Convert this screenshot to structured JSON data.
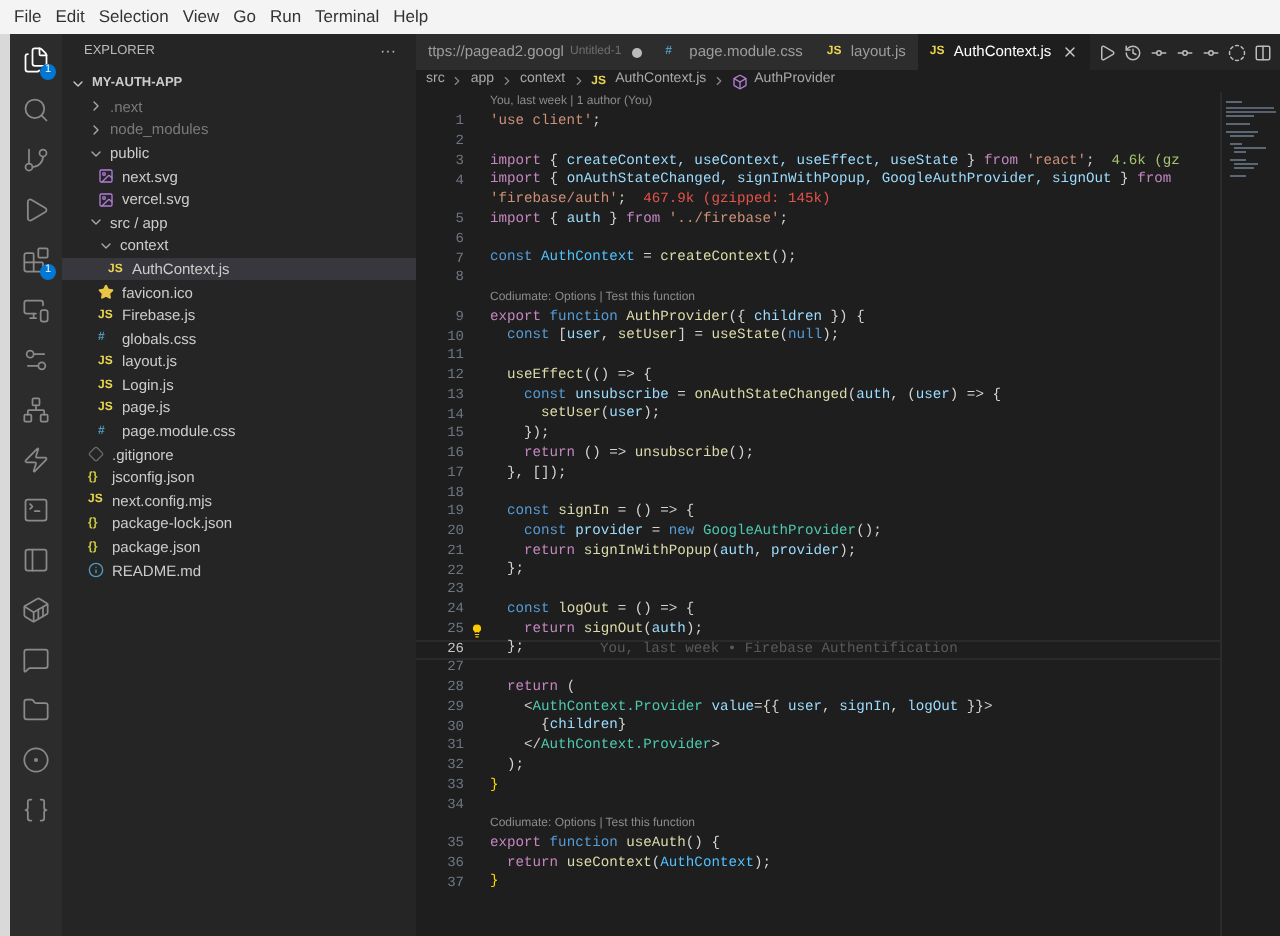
{
  "menu_bar": [
    "File",
    "Edit",
    "Selection",
    "View",
    "Go",
    "Run",
    "Terminal",
    "Help"
  ],
  "activity_bar": [
    {
      "kind": "files",
      "badge": "1",
      "selected": true
    },
    {
      "kind": "search",
      "selected": false
    },
    {
      "kind": "source-control",
      "selected": false
    },
    {
      "kind": "run",
      "selected": false
    },
    {
      "kind": "extensions",
      "badge": "1",
      "selected": false
    },
    {
      "kind": "remote",
      "selected": false
    },
    {
      "kind": "r",
      "selected": false
    },
    {
      "kind": "diagram",
      "selected": false
    },
    {
      "kind": "bolt",
      "selected": false
    },
    {
      "kind": "terminal",
      "selected": false
    },
    {
      "kind": "panel",
      "selected": false
    },
    {
      "kind": "docker",
      "selected": false
    },
    {
      "kind": "chat",
      "selected": false
    },
    {
      "kind": "folder",
      "selected": false
    },
    {
      "kind": "timeline",
      "selected": false
    },
    {
      "kind": "json",
      "selected": false
    }
  ],
  "sidebar": {
    "title": "EXPLORER",
    "more": "···",
    "root": {
      "label": "MY-AUTH-APP",
      "expanded": true,
      "children": [
        {
          "label": ".next",
          "kind": "folder",
          "expanded": false,
          "ignored": true,
          "selected": false
        },
        {
          "label": "node_modules",
          "kind": "folder",
          "expanded": false,
          "ignored": true,
          "selected": false
        },
        {
          "label": "public",
          "kind": "folder",
          "expanded": true,
          "ignored": false,
          "selected": false,
          "children": [
            {
              "label": "next.svg",
              "kind": "svg",
              "ignored": false,
              "selected": false
            },
            {
              "label": "vercel.svg",
              "kind": "svg",
              "ignored": false,
              "selected": false
            }
          ]
        },
        {
          "label": "src / app",
          "kind": "folder",
          "expanded": true,
          "ignored": false,
          "selected": false,
          "children": [
            {
              "label": "context",
              "kind": "folder",
              "expanded": true,
              "ignored": false,
              "selected": false,
              "children": [
                {
                  "label": "AuthContext.js",
                  "kind": "js",
                  "icon_text": "JS",
                  "ignored": false,
                  "selected": true
                }
              ]
            },
            {
              "label": "favicon.ico",
              "kind": "ico",
              "ignored": false,
              "selected": false
            },
            {
              "label": "Firebase.js",
              "kind": "js",
              "icon_text": "JS",
              "ignored": false,
              "selected": false
            },
            {
              "label": "globals.css",
              "kind": "css",
              "icon_text": "#",
              "ignored": false,
              "selected": false
            },
            {
              "label": "layout.js",
              "kind": "js",
              "icon_text": "JS",
              "ignored": false,
              "selected": false
            },
            {
              "label": "Login.js",
              "kind": "js",
              "icon_text": "JS",
              "ignored": false,
              "selected": false
            },
            {
              "label": "page.js",
              "kind": "js",
              "icon_text": "JS",
              "ignored": false,
              "selected": false
            },
            {
              "label": "page.module.css",
              "kind": "css",
              "icon_text": "#",
              "ignored": false,
              "selected": false
            }
          ]
        },
        {
          "label": ".gitignore",
          "kind": "git",
          "ignored": false,
          "selected": false
        },
        {
          "label": "jsconfig.json",
          "kind": "json",
          "icon_text": "{}",
          "ignored": false,
          "selected": false
        },
        {
          "label": "next.config.mjs",
          "kind": "js",
          "icon_text": "JS",
          "ignored": false,
          "selected": false
        },
        {
          "label": "package-lock.json",
          "kind": "json",
          "icon_text": "{}",
          "ignored": false,
          "selected": false
        },
        {
          "label": "package.json",
          "kind": "json",
          "icon_text": "{}",
          "ignored": false,
          "selected": false
        },
        {
          "label": "README.md",
          "kind": "info",
          "ignored": false,
          "selected": false
        }
      ]
    }
  },
  "tabs": [
    {
      "label": "ttps://pagead2.googl",
      "note": "Untitled-1",
      "dirty": true,
      "selected": false
    },
    {
      "label": "page.module.css",
      "kind": "css",
      "icon_text": "#",
      "dirty": false,
      "selected": false
    },
    {
      "label": "layout.js",
      "kind": "js",
      "icon_text": "JS",
      "dirty": false,
      "selected": false
    },
    {
      "label": "AuthContext.js",
      "kind": "js",
      "icon_text": "JS",
      "dirty": false,
      "selected": true
    }
  ],
  "tab_tools": [
    {
      "kind": "play"
    },
    {
      "kind": "history"
    },
    {
      "kind": "commit"
    },
    {
      "kind": "commit"
    },
    {
      "kind": "commit"
    },
    {
      "kind": "circle"
    },
    {
      "kind": "split"
    }
  ],
  "breadcrumbs": [
    {
      "label": "src",
      "kind": "folder"
    },
    {
      "label": "app",
      "kind": "folder"
    },
    {
      "label": "context",
      "kind": "folder"
    },
    {
      "label": "AuthContext.js",
      "kind": "js",
      "icon_text": "JS"
    },
    {
      "label": "AuthProvider",
      "kind": "symbol"
    }
  ],
  "editor": {
    "lines": [
      {
        "number": "1",
        "current": false,
        "lens": "You, last week | 1 author (You)",
        "tokens": [
          {
            "text": "'use client'",
            "kind": "str"
          },
          {
            "text": ";",
            "kind": "p"
          }
        ]
      },
      {
        "number": "2",
        "current": false
      },
      {
        "number": "3",
        "current": false,
        "tokens": [
          {
            "text": "import",
            "kind": "kw"
          },
          {
            "text": " { ",
            "kind": "p"
          },
          {
            "text": "createContext, useContext, useEffect, useState",
            "kind": "var"
          },
          {
            "text": " } ",
            "kind": "p"
          },
          {
            "text": "from",
            "kind": "kw"
          },
          {
            "text": " 'react'",
            "kind": "str"
          },
          {
            "text": ";",
            "kind": "p"
          },
          {
            "text": "  4.6k (gz",
            "kind": "size-ok"
          }
        ]
      },
      {
        "number": "4",
        "current": false,
        "tokens": [
          {
            "text": "import",
            "kind": "kw"
          },
          {
            "text": " { ",
            "kind": "p"
          },
          {
            "text": "onAuthStateChanged, signInWithPopup, GoogleAuthProvider, signOut",
            "kind": "var"
          },
          {
            "text": " } ",
            "kind": "p"
          },
          {
            "text": "from",
            "kind": "kw"
          }
        ],
        "wrap": [
          {
            "text": "'firebase/auth'",
            "kind": "str"
          },
          {
            "text": ";",
            "kind": "p"
          },
          {
            "text": "  467.9k (gzipped: 145k)",
            "kind": "size-big"
          }
        ]
      },
      {
        "number": "5",
        "current": false,
        "tokens": [
          {
            "text": "import",
            "kind": "kw"
          },
          {
            "text": " { ",
            "kind": "p"
          },
          {
            "text": "auth",
            "kind": "var"
          },
          {
            "text": " } ",
            "kind": "p"
          },
          {
            "text": "from",
            "kind": "kw"
          },
          {
            "text": " '../firebase'",
            "kind": "str"
          },
          {
            "text": ";",
            "kind": "p"
          }
        ]
      },
      {
        "number": "6",
        "current": false
      },
      {
        "number": "7",
        "current": false,
        "tokens": [
          {
            "text": "const",
            "kind": "decl"
          },
          {
            "text": " AuthContext",
            "kind": "const"
          },
          {
            "text": " = ",
            "kind": "p"
          },
          {
            "text": "createContext",
            "kind": "fn"
          },
          {
            "text": "();",
            "kind": "p"
          }
        ]
      },
      {
        "number": "8",
        "current": false
      },
      {
        "number": "9",
        "current": false,
        "lens": "Codiumate: Options | Test this function",
        "tokens": [
          {
            "text": "export",
            "kind": "kw"
          },
          {
            "text": " function",
            "kind": "decl"
          },
          {
            "text": " AuthProvider",
            "kind": "fn"
          },
          {
            "text": "({ ",
            "kind": "p"
          },
          {
            "text": "children",
            "kind": "var"
          },
          {
            "text": " }) {",
            "kind": "p"
          }
        ]
      },
      {
        "number": "10",
        "current": false,
        "tokens": [
          {
            "text": "  const",
            "kind": "decl"
          },
          {
            "text": " [",
            "kind": "p"
          },
          {
            "text": "user",
            "kind": "var"
          },
          {
            "text": ", ",
            "kind": "p"
          },
          {
            "text": "setUser",
            "kind": "fn"
          },
          {
            "text": "] = ",
            "kind": "p"
          },
          {
            "text": "useState",
            "kind": "fn"
          },
          {
            "text": "(",
            "kind": "p"
          },
          {
            "text": "null",
            "kind": "decl"
          },
          {
            "text": ");",
            "kind": "p"
          }
        ]
      },
      {
        "number": "11",
        "current": false
      },
      {
        "number": "12",
        "current": false,
        "tokens": [
          {
            "text": "  useEffect",
            "kind": "fn"
          },
          {
            "text": "(() => {",
            "kind": "p"
          }
        ]
      },
      {
        "number": "13",
        "current": false,
        "tokens": [
          {
            "text": "    const",
            "kind": "decl"
          },
          {
            "text": " unsubscribe",
            "kind": "var"
          },
          {
            "text": " = ",
            "kind": "p"
          },
          {
            "text": "onAuthStateChanged",
            "kind": "fn"
          },
          {
            "text": "(",
            "kind": "p"
          },
          {
            "text": "auth",
            "kind": "var"
          },
          {
            "text": ", (",
            "kind": "p"
          },
          {
            "text": "user",
            "kind": "var"
          },
          {
            "text": ") => {",
            "kind": "p"
          }
        ]
      },
      {
        "number": "14",
        "current": false,
        "tokens": [
          {
            "text": "      setUser",
            "kind": "fn"
          },
          {
            "text": "(",
            "kind": "p"
          },
          {
            "text": "user",
            "kind": "var"
          },
          {
            "text": ");",
            "kind": "p"
          }
        ]
      },
      {
        "number": "15",
        "current": false,
        "tokens": [
          {
            "text": "    });",
            "kind": "p"
          }
        ]
      },
      {
        "number": "16",
        "current": false,
        "tokens": [
          {
            "text": "    return",
            "kind": "kw"
          },
          {
            "text": " () => ",
            "kind": "p"
          },
          {
            "text": "unsubscribe",
            "kind": "fn"
          },
          {
            "text": "();",
            "kind": "p"
          }
        ]
      },
      {
        "number": "17",
        "current": false,
        "tokens": [
          {
            "text": "  }, []);",
            "kind": "p"
          }
        ]
      },
      {
        "number": "18",
        "current": false
      },
      {
        "number": "19",
        "current": false,
        "tokens": [
          {
            "text": "  const",
            "kind": "decl"
          },
          {
            "text": " signIn",
            "kind": "fn"
          },
          {
            "text": " = () => {",
            "kind": "p"
          }
        ]
      },
      {
        "number": "20",
        "current": false,
        "tokens": [
          {
            "text": "    const",
            "kind": "decl"
          },
          {
            "text": " provider",
            "kind": "var"
          },
          {
            "text": " = ",
            "kind": "p"
          },
          {
            "text": "new",
            "kind": "decl"
          },
          {
            "text": " GoogleAuthProvider",
            "kind": "cls"
          },
          {
            "text": "();",
            "kind": "p"
          }
        ]
      },
      {
        "number": "21",
        "current": false,
        "tokens": [
          {
            "text": "    return",
            "kind": "kw"
          },
          {
            "text": " signInWithPopup",
            "kind": "fn"
          },
          {
            "text": "(",
            "kind": "p"
          },
          {
            "text": "auth",
            "kind": "var"
          },
          {
            "text": ", ",
            "kind": "p"
          },
          {
            "text": "provider",
            "kind": "var"
          },
          {
            "text": ");",
            "kind": "p"
          }
        ]
      },
      {
        "number": "22",
        "current": false,
        "tokens": [
          {
            "text": "  };",
            "kind": "p"
          }
        ]
      },
      {
        "number": "23",
        "current": false
      },
      {
        "number": "24",
        "current": false,
        "tokens": [
          {
            "text": "  const",
            "kind": "decl"
          },
          {
            "text": " logOut",
            "kind": "fn"
          },
          {
            "text": " = () => {",
            "kind": "p"
          }
        ]
      },
      {
        "number": "25",
        "current": false,
        "lightbulb": true,
        "tokens": [
          {
            "text": "    return",
            "kind": "kw"
          },
          {
            "text": " signOut",
            "kind": "fn"
          },
          {
            "text": "(",
            "kind": "p"
          },
          {
            "text": "auth",
            "kind": "var"
          },
          {
            "text": ");",
            "kind": "p"
          }
        ]
      },
      {
        "number": "26",
        "current": true,
        "blame": "You, last week • Firebase Authentification",
        "tokens": [
          {
            "text": "  };",
            "kind": "p"
          }
        ]
      },
      {
        "number": "27",
        "current": false
      },
      {
        "number": "28",
        "current": false,
        "tokens": [
          {
            "text": "  return",
            "kind": "kw"
          },
          {
            "text": " (",
            "kind": "p"
          }
        ]
      },
      {
        "number": "29",
        "current": false,
        "tokens": [
          {
            "text": "    <",
            "kind": "p"
          },
          {
            "text": "AuthContext.Provider",
            "kind": "cls"
          },
          {
            "text": " value",
            "kind": "var"
          },
          {
            "text": "={{ ",
            "kind": "p"
          },
          {
            "text": "user",
            "kind": "var"
          },
          {
            "text": ", ",
            "kind": "p"
          },
          {
            "text": "signIn",
            "kind": "var"
          },
          {
            "text": ", ",
            "kind": "p"
          },
          {
            "text": "logOut",
            "kind": "var"
          },
          {
            "text": " }}>",
            "kind": "p"
          }
        ]
      },
      {
        "number": "30",
        "current": false,
        "tokens": [
          {
            "text": "      {",
            "kind": "p"
          },
          {
            "text": "children",
            "kind": "var"
          },
          {
            "text": "}",
            "kind": "p"
          }
        ]
      },
      {
        "number": "31",
        "current": false,
        "tokens": [
          {
            "text": "    </",
            "kind": "p"
          },
          {
            "text": "AuthContext.Provider",
            "kind": "cls"
          },
          {
            "text": ">",
            "kind": "p"
          }
        ]
      },
      {
        "number": "32",
        "current": false,
        "tokens": [
          {
            "text": "  );",
            "kind": "p"
          }
        ]
      },
      {
        "number": "33",
        "current": false,
        "tokens": [
          {
            "text": "}",
            "kind": "brace"
          }
        ]
      },
      {
        "number": "34",
        "current": false
      },
      {
        "number": "35",
        "current": false,
        "lens": "Codiumate: Options | Test this function",
        "tokens": [
          {
            "text": "export",
            "kind": "kw"
          },
          {
            "text": " function",
            "kind": "decl"
          },
          {
            "text": " useAuth",
            "kind": "fn"
          },
          {
            "text": "() {",
            "kind": "p"
          }
        ]
      },
      {
        "number": "36",
        "current": false,
        "tokens": [
          {
            "text": "  return",
            "kind": "kw"
          },
          {
            "text": " useContext",
            "kind": "fn"
          },
          {
            "text": "(",
            "kind": "p"
          },
          {
            "text": "AuthContext",
            "kind": "const"
          },
          {
            "text": ");",
            "kind": "p"
          }
        ]
      },
      {
        "number": "37",
        "current": false,
        "tokens": [
          {
            "text": "}",
            "kind": "brace"
          }
        ]
      }
    ]
  }
}
